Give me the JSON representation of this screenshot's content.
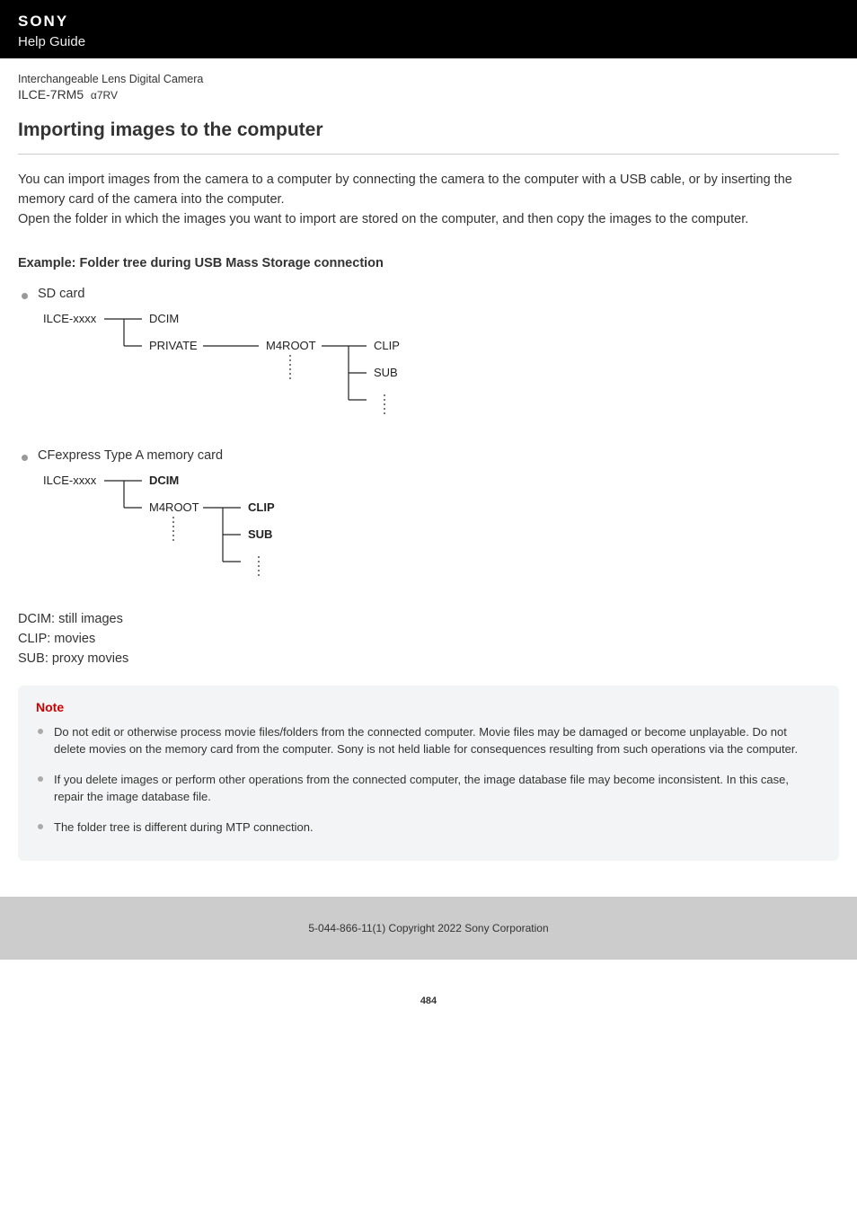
{
  "header": {
    "brand": "SONY",
    "help_guide": "Help Guide"
  },
  "product": {
    "type": "Interchangeable Lens Digital Camera",
    "model_main": "ILCE-7RM5",
    "model_sub": "α7RV"
  },
  "page_title": "Importing images to the computer",
  "intro_p1": "You can import images from the camera to a computer by connecting the camera to the computer with a USB cable, or by inserting the memory card of the camera into the computer.",
  "intro_p2": "Open the folder in which the images you want to import are stored on the computer, and then copy the images to the computer.",
  "example_title": "Example: Folder tree during USB Mass Storage connection",
  "tree_items": {
    "sd": "SD card",
    "cf": "CFexpress Type A memory card"
  },
  "tree_labels": {
    "root": "ILCE-xxxx",
    "dcim": "DCIM",
    "private": "PRIVATE",
    "m4root": "M4ROOT",
    "clip": "CLIP",
    "sub": "SUB"
  },
  "legend": {
    "l1": "DCIM: still images",
    "l2": "CLIP: movies",
    "l3": "SUB: proxy movies"
  },
  "note": {
    "title": "Note",
    "items": [
      "Do not edit or otherwise process movie files/folders from the connected computer. Movie files may be damaged or become unplayable. Do not delete movies on the memory card from the computer. Sony is not held liable for consequences resulting from such operations via the computer.",
      "If you delete images or perform other operations from the connected computer, the image database file may become inconsistent. In this case, repair the image database file.",
      "The folder tree is different during MTP connection."
    ]
  },
  "footer": "5-044-866-11(1) Copyright 2022 Sony Corporation",
  "page_num": "484"
}
